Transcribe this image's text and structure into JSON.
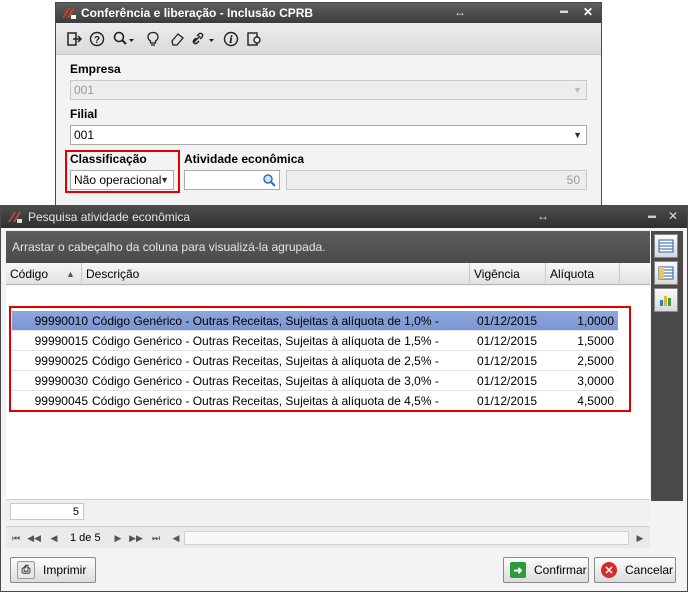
{
  "window_back": {
    "title": "Conferência e liberação - Inclusão CPRB",
    "resize_glyph": "↔",
    "min_glyph": "▬",
    "close_glyph": "✕",
    "toolbar_icons": [
      "exit-icon",
      "help-icon",
      "zoom-icon",
      "lightbulb-icon",
      "eraser-icon",
      "link-icon",
      "info-icon",
      "settings-icon"
    ],
    "empresa_label": "Empresa",
    "empresa_value": "001",
    "filial_label": "Filial",
    "filial_value": "001",
    "classificacao_label": "Classificação",
    "classificacao_value": "Não operacional",
    "atividade_label": "Atividade econômica",
    "atividade_value": "",
    "aliquota_value": "50"
  },
  "window_front": {
    "title": "Pesquisa atividade econômica",
    "resize_glyph": "↔",
    "min_glyph": "▬",
    "close_glyph": "✕",
    "group_hint": "Arrastar o cabeçalho da coluna para visualizá-la agrupada.",
    "columns": {
      "codigo": "Código",
      "descricao": "Descrição",
      "vigencia": "Vigência",
      "aliquota": "Alíquota"
    },
    "rows": [
      {
        "codigo": "99990010",
        "descricao": "Código Genérico - Outras Receitas, Sujeitas à alíquota de 1,0% -",
        "vigencia": "01/12/2015",
        "aliquota": "1,0000"
      },
      {
        "codigo": "99990015",
        "descricao": "Código Genérico - Outras Receitas, Sujeitas à alíquota de 1,5% -",
        "vigencia": "01/12/2015",
        "aliquota": "1,5000"
      },
      {
        "codigo": "99990025",
        "descricao": "Código Genérico - Outras Receitas, Sujeitas à alíquota de 2,5% -",
        "vigencia": "01/12/2015",
        "aliquota": "2,5000"
      },
      {
        "codigo": "99990030",
        "descricao": "Código Genérico - Outras Receitas, Sujeitas à alíquota de 3,0% -",
        "vigencia": "01/12/2015",
        "aliquota": "3,0000"
      },
      {
        "codigo": "99990045",
        "descricao": "Código Genérico - Outras Receitas, Sujeitas à alíquota de 4,5% -",
        "vigencia": "01/12/2015",
        "aliquota": "4,5000"
      }
    ],
    "footer_count": "5",
    "pager_text": "1 de 5",
    "btn_imprimir": "Imprimir",
    "btn_confirmar": "Confirmar",
    "btn_cancelar": "Cancelar"
  },
  "colors": {
    "selected_row": "#7f9ad6",
    "highlight": "#e00000",
    "titlebar": "#3c3c3c"
  }
}
